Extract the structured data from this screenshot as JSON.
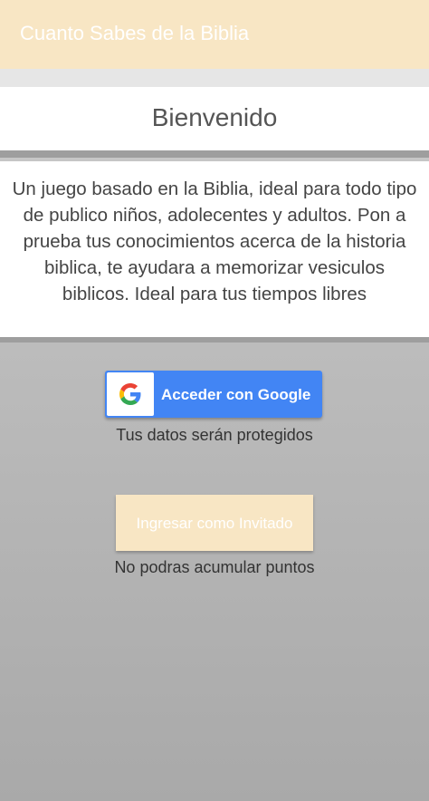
{
  "app": {
    "title": "Cuanto Sabes de la Biblia"
  },
  "welcome": {
    "title": "Bienvenido"
  },
  "description": {
    "text": "Un juego basado en la Biblia, ideal para todo tipo de publico niños, adolecentes y adultos. Pon a prueba tus conocimientos acerca de la historia biblica, te ayudara a memorizar vesiculos biblicos. Ideal para tus tiempos libres"
  },
  "google_signin": {
    "label": "Acceder con Google",
    "note": "Tus datos serán protegidos",
    "icon": "google-g-logo"
  },
  "guest": {
    "label": "Ingresar como Invitado",
    "note": "No podras acumular puntos"
  },
  "colors": {
    "appbar": "#f8e6c4",
    "google_blue": "#4285f4",
    "guest_button": "#f8e6c4"
  }
}
